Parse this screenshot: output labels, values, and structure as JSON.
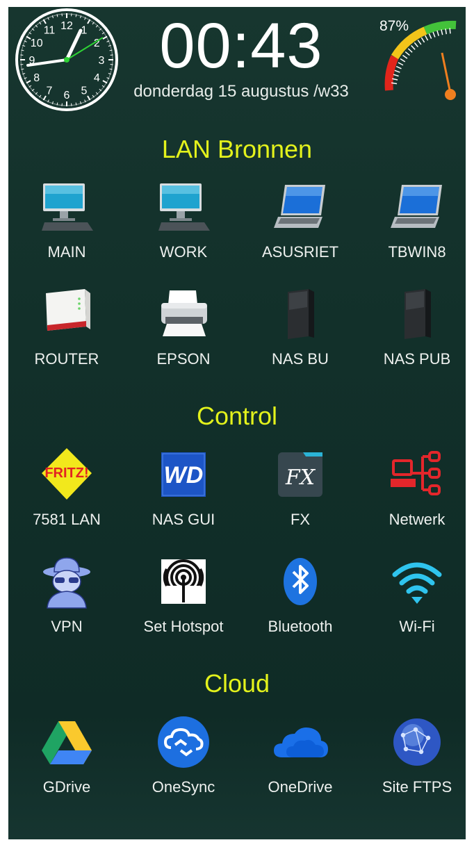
{
  "clock": {
    "time": "00:43",
    "date": "donderdag 15 augustus /w33",
    "dial_numbers": [
      "12",
      "1",
      "2",
      "3",
      "4",
      "5",
      "6",
      "7",
      "8",
      "9",
      "10",
      "11"
    ]
  },
  "battery": {
    "percent_label": "87%",
    "level": 0.87
  },
  "sections": [
    {
      "title": "LAN Bronnen",
      "items": [
        {
          "label": "MAIN",
          "icon": "desktop-computer-icon"
        },
        {
          "label": "WORK",
          "icon": "desktop-computer-icon"
        },
        {
          "label": "ASUSRIET",
          "icon": "laptop-icon"
        },
        {
          "label": "TBWIN8",
          "icon": "laptop-icon"
        },
        {
          "label": "ROUTER",
          "icon": "router-icon"
        },
        {
          "label": "EPSON",
          "icon": "printer-icon"
        },
        {
          "label": "NAS BU",
          "icon": "nas-drive-icon"
        },
        {
          "label": "NAS PUB",
          "icon": "nas-drive-icon"
        }
      ]
    },
    {
      "title": "Control",
      "items": [
        {
          "label": "7581 LAN",
          "icon": "fritz-logo-icon",
          "icon_text": "FRITZ!"
        },
        {
          "label": "NAS GUI",
          "icon": "wd-logo-icon",
          "icon_text": "WD"
        },
        {
          "label": "FX",
          "icon": "fx-file-explorer-icon",
          "icon_text": "FX"
        },
        {
          "label": "Netwerk",
          "icon": "network-diagram-icon"
        },
        {
          "label": "VPN",
          "icon": "spy-agent-icon"
        },
        {
          "label": "Set Hotspot",
          "icon": "hotspot-antenna-icon"
        },
        {
          "label": "Bluetooth",
          "icon": "bluetooth-icon"
        },
        {
          "label": "Wi-Fi",
          "icon": "wifi-icon"
        }
      ]
    },
    {
      "title": "Cloud",
      "items": [
        {
          "label": "GDrive",
          "icon": "google-drive-icon"
        },
        {
          "label": "OneSync",
          "icon": "cloud-sync-icon"
        },
        {
          "label": "OneDrive",
          "icon": "onedrive-cloud-icon"
        },
        {
          "label": "Site FTPS",
          "icon": "globe-network-icon"
        }
      ]
    }
  ],
  "colors": {
    "section_title": "#e3f21c",
    "background": "#12302a",
    "gauge_red": "#e0251b",
    "gauge_yellow": "#f2c41a",
    "gauge_green": "#43c23a",
    "gauge_needle": "#f07f1f"
  }
}
